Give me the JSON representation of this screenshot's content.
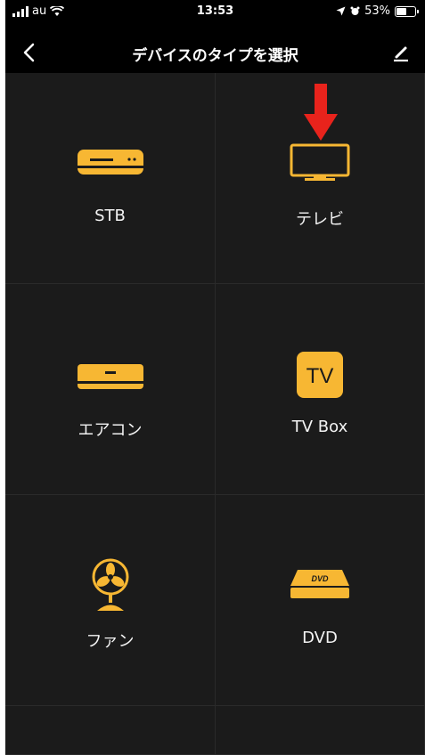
{
  "status_bar": {
    "carrier": "au",
    "time": "13:53",
    "battery": "53%"
  },
  "header": {
    "title": "デバイスのタイプを選択"
  },
  "devices": [
    {
      "label": "STB",
      "icon": "stb-icon"
    },
    {
      "label": "テレビ",
      "icon": "tv-icon"
    },
    {
      "label": "エアコン",
      "icon": "air-conditioner-icon"
    },
    {
      "label": "TV Box",
      "icon": "tv-box-icon",
      "icon_text": "TV"
    },
    {
      "label": "ファン",
      "icon": "fan-icon"
    },
    {
      "label": "DVD",
      "icon": "dvd-icon",
      "icon_text": "DVD"
    }
  ],
  "colors": {
    "accent": "#F7B733",
    "background": "#1B1B1B",
    "header": "#000000",
    "annotation_arrow": "#E8231C"
  }
}
